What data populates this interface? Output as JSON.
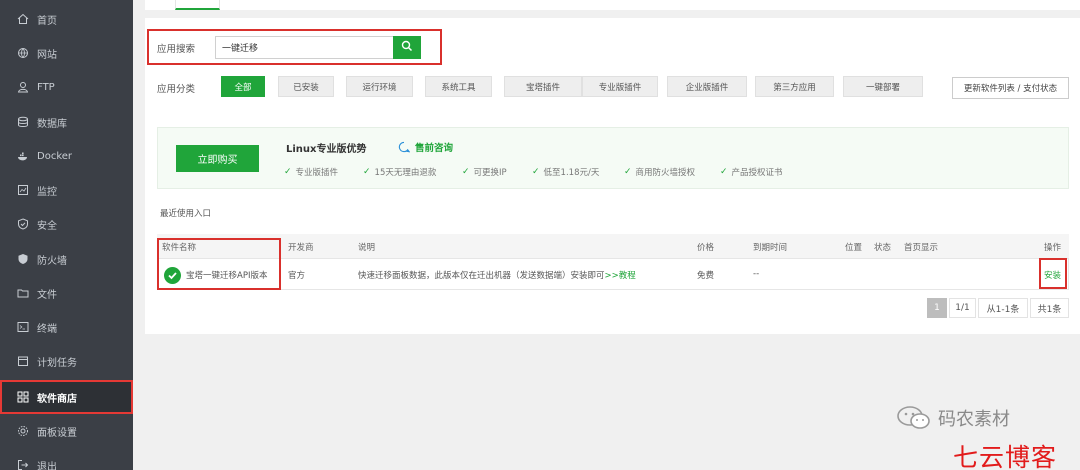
{
  "sidebar": {
    "items": [
      {
        "label": "首页",
        "icon": "home-icon"
      },
      {
        "label": "网站",
        "icon": "globe-icon"
      },
      {
        "label": "FTP",
        "icon": "ftp-icon"
      },
      {
        "label": "数据库",
        "icon": "database-icon"
      },
      {
        "label": "Docker",
        "icon": "docker-icon"
      },
      {
        "label": "监控",
        "icon": "monitor-icon"
      },
      {
        "label": "安全",
        "icon": "shield-icon"
      },
      {
        "label": "防火墙",
        "icon": "firewall-icon"
      },
      {
        "label": "文件",
        "icon": "folder-icon"
      },
      {
        "label": "终端",
        "icon": "terminal-icon"
      },
      {
        "label": "计划任务",
        "icon": "calendar-icon"
      },
      {
        "label": "软件商店",
        "icon": "grid-icon"
      },
      {
        "label": "面板设置",
        "icon": "gear-icon"
      },
      {
        "label": "退出",
        "icon": "logout-icon"
      }
    ],
    "active": "软件商店"
  },
  "search": {
    "label": "应用搜索",
    "value": "一键迁移"
  },
  "category": {
    "label": "应用分类",
    "items": [
      "全部",
      "已安装",
      "运行环境",
      "系统工具",
      "宝塔插件",
      "专业版插件",
      "企业版插件",
      "第三方应用",
      "一键部署"
    ],
    "active": "全部",
    "update_button": "更新软件列表 / 支付状态"
  },
  "promo": {
    "buy_button": "立即购买",
    "title": "Linux专业版优势",
    "consult": "售前咨询",
    "features": [
      "专业版插件",
      "15天无理由退款",
      "可更换IP",
      "低至1.18元/天",
      "商用防火墙授权",
      "产品授权证书"
    ]
  },
  "recent_label": "最近使用入口",
  "table": {
    "headers": {
      "name": "软件名称",
      "developer": "开发商",
      "description": "说明",
      "price": "价格",
      "expire": "到期时间",
      "position": "位置",
      "status": "状态",
      "homepage": "首页显示",
      "action": "操作"
    },
    "rows": [
      {
        "name": "宝塔一键迁移API版本",
        "developer": "官方",
        "description": "快速迁移面板数据，此版本仅在迁出机器（发送数据端）安装即可",
        "tutorial": ">>教程",
        "price": "免费",
        "expire": "--",
        "action": "安装"
      }
    ]
  },
  "pagination": {
    "current": "1",
    "pages": "1/1",
    "range": "从1-1条",
    "total": "共1条"
  },
  "watermark": {
    "text": "码农素材",
    "blog": "七云博客"
  },
  "colors": {
    "accent": "#20a53a",
    "sidebar_bg": "#3b3f46",
    "highlight_red": "#d9302c",
    "blog_red": "#e21b1b"
  }
}
